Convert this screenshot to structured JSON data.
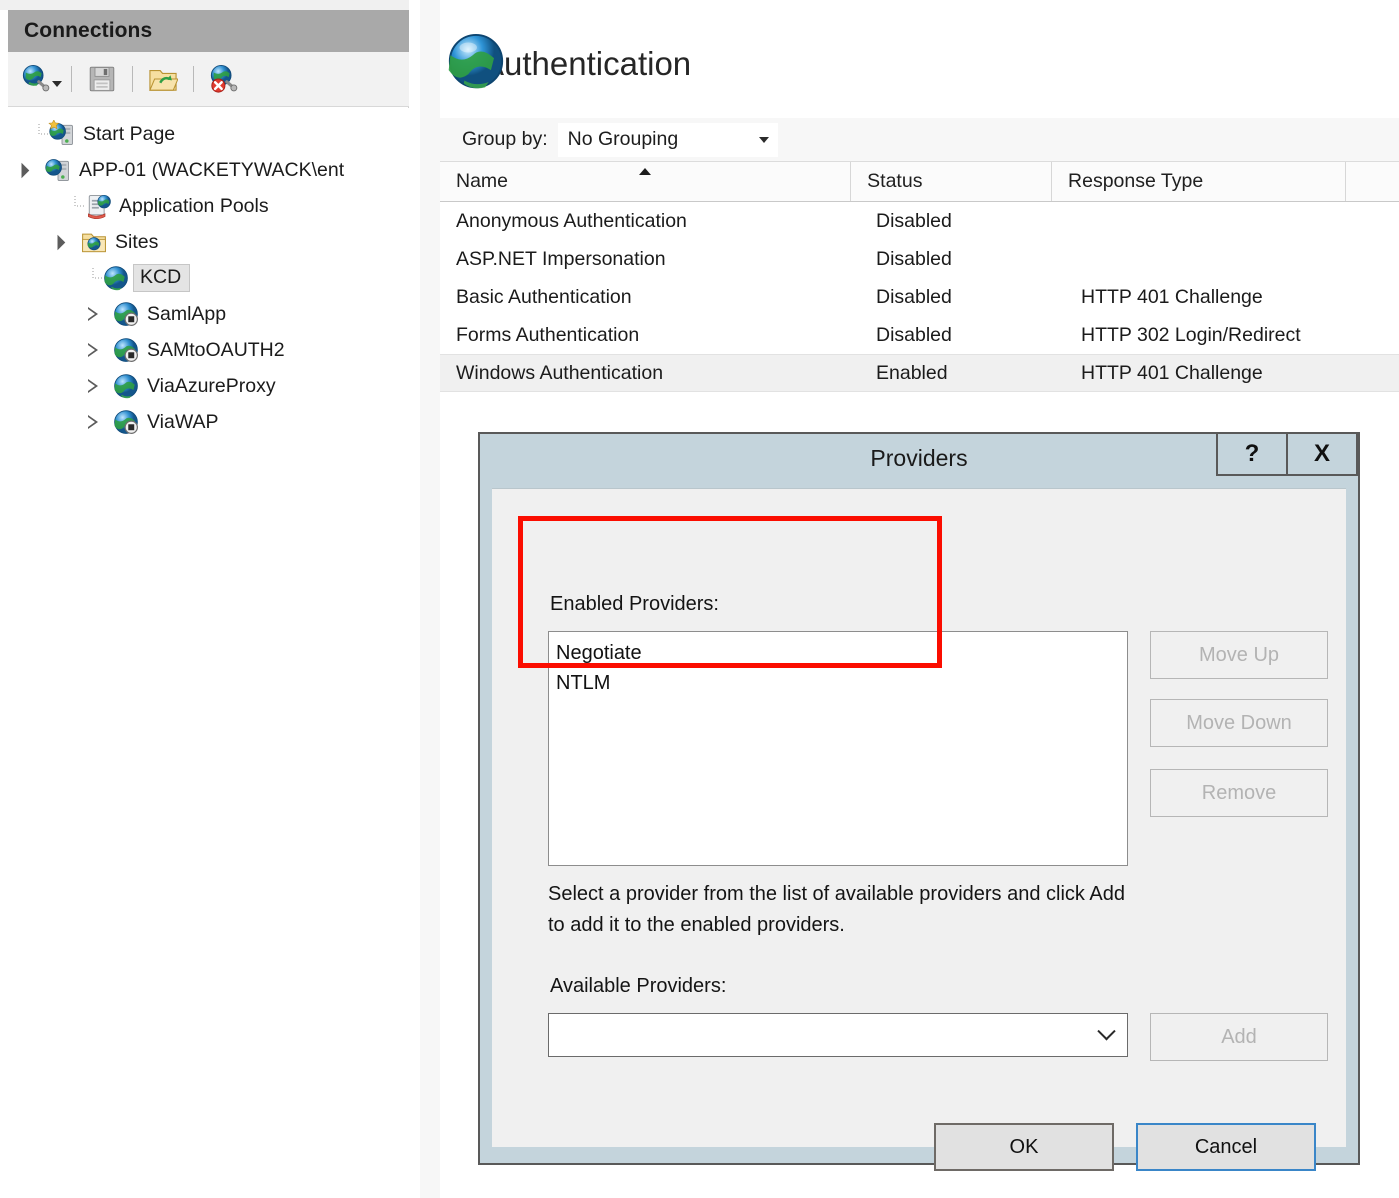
{
  "sidebar": {
    "header_title": "Connections",
    "toolbar": [
      {
        "name": "connect-icon",
        "label": "Connect to"
      },
      {
        "name": "save-connections-icon",
        "label": "Save Connections"
      },
      {
        "name": "open-site-icon",
        "label": "Open Site"
      },
      {
        "name": "disconnect-icon",
        "label": "Disconnect"
      }
    ],
    "tree": [
      {
        "label": "Start Page",
        "icon": "start-page-icon",
        "indent": 0,
        "twisty": "none",
        "selected": false
      },
      {
        "label": "APP-01 (WACKETYWACK\\ent",
        "icon": "server-icon",
        "indent": 0,
        "twisty": "expanded",
        "selected": false
      },
      {
        "label": "Application Pools",
        "icon": "app-pools-icon",
        "indent": 1,
        "twisty": "none",
        "selected": false
      },
      {
        "label": "Sites",
        "icon": "sites-folder-icon",
        "indent": 1,
        "twisty": "expanded",
        "selected": false
      },
      {
        "label": "KCD",
        "icon": "site-icon",
        "indent": 2,
        "twisty": "none",
        "selected": true
      },
      {
        "label": "SamlApp",
        "icon": "site-stopped-icon",
        "indent": 2,
        "twisty": "collapsed",
        "selected": false
      },
      {
        "label": "SAMtoOAUTH2",
        "icon": "site-stopped-icon",
        "indent": 2,
        "twisty": "collapsed",
        "selected": false
      },
      {
        "label": "ViaAzureProxy",
        "icon": "site-icon",
        "indent": 2,
        "twisty": "collapsed",
        "selected": false
      },
      {
        "label": "ViaWAP",
        "icon": "site-stopped-icon",
        "indent": 2,
        "twisty": "collapsed",
        "selected": false
      }
    ]
  },
  "page": {
    "title": "Authentication",
    "icon": "authentication-globe-icon"
  },
  "groupbar": {
    "label": "Group by:",
    "selected": "No Grouping"
  },
  "listview": {
    "columns": [
      "Name",
      "Status",
      "Response Type",
      ""
    ],
    "sorted_column": "Name",
    "sort_direction": "ascending",
    "rows": [
      {
        "name": "Anonymous Authentication",
        "status": "Disabled",
        "response_type": "",
        "selected": false
      },
      {
        "name": "ASP.NET Impersonation",
        "status": "Disabled",
        "response_type": "",
        "selected": false
      },
      {
        "name": "Basic Authentication",
        "status": "Disabled",
        "response_type": "HTTP 401 Challenge",
        "selected": false
      },
      {
        "name": "Forms Authentication",
        "status": "Disabled",
        "response_type": "HTTP 302 Login/Redirect",
        "selected": false
      },
      {
        "name": "Windows Authentication",
        "status": "Enabled",
        "response_type": "HTTP 401 Challenge",
        "selected": true
      }
    ]
  },
  "dialog": {
    "title": "Providers",
    "help_button": "?",
    "close_button": "X",
    "enabled_providers_label": "Enabled Providers:",
    "enabled_providers": [
      "Negotiate",
      "NTLM"
    ],
    "move_up": "Move Up",
    "move_down": "Move Down",
    "remove": "Remove",
    "help_text_line1": "Select a provider from the list of available providers and click Add",
    "help_text_line2": "to add it to the enabled providers.",
    "available_providers_label": "Available Providers:",
    "available_selected": "",
    "add": "Add",
    "ok": "OK",
    "cancel": "Cancel"
  },
  "annotation": {
    "name": "red-highlight-box",
    "color": "#fb0d00"
  }
}
